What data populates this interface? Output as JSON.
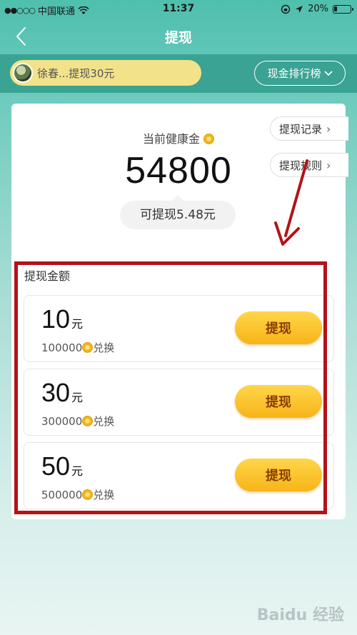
{
  "status_bar": {
    "carrier": "中国联通",
    "time": "11:37",
    "battery": "20%",
    "battery_level": 0.2
  },
  "nav": {
    "title": "提现",
    "back_icon": "chevron-left-icon"
  },
  "ticker": {
    "text": "徐春...提现30元",
    "rank_button": "现金排行榜"
  },
  "balance": {
    "label": "当前健康金",
    "value": "54800",
    "withdrawable": "可提现5.48元"
  },
  "links": {
    "records": "提现记录",
    "rules": "提现规则"
  },
  "section": {
    "title": "提现金额"
  },
  "options": [
    {
      "amount": "10",
      "unit": "元",
      "cost": "100000",
      "exchange": "兑换",
      "button": "提现"
    },
    {
      "amount": "30",
      "unit": "元",
      "cost": "300000",
      "exchange": "兑换",
      "button": "提现"
    },
    {
      "amount": "50",
      "unit": "元",
      "cost": "500000",
      "exchange": "兑换",
      "button": "提现"
    }
  ],
  "watermark": "Baidu 经验",
  "colors": {
    "accent": "#4fbfae",
    "ticker_bg": "#3aa393",
    "button_yellow": "#f7b418",
    "highlight_red": "#b41217"
  }
}
